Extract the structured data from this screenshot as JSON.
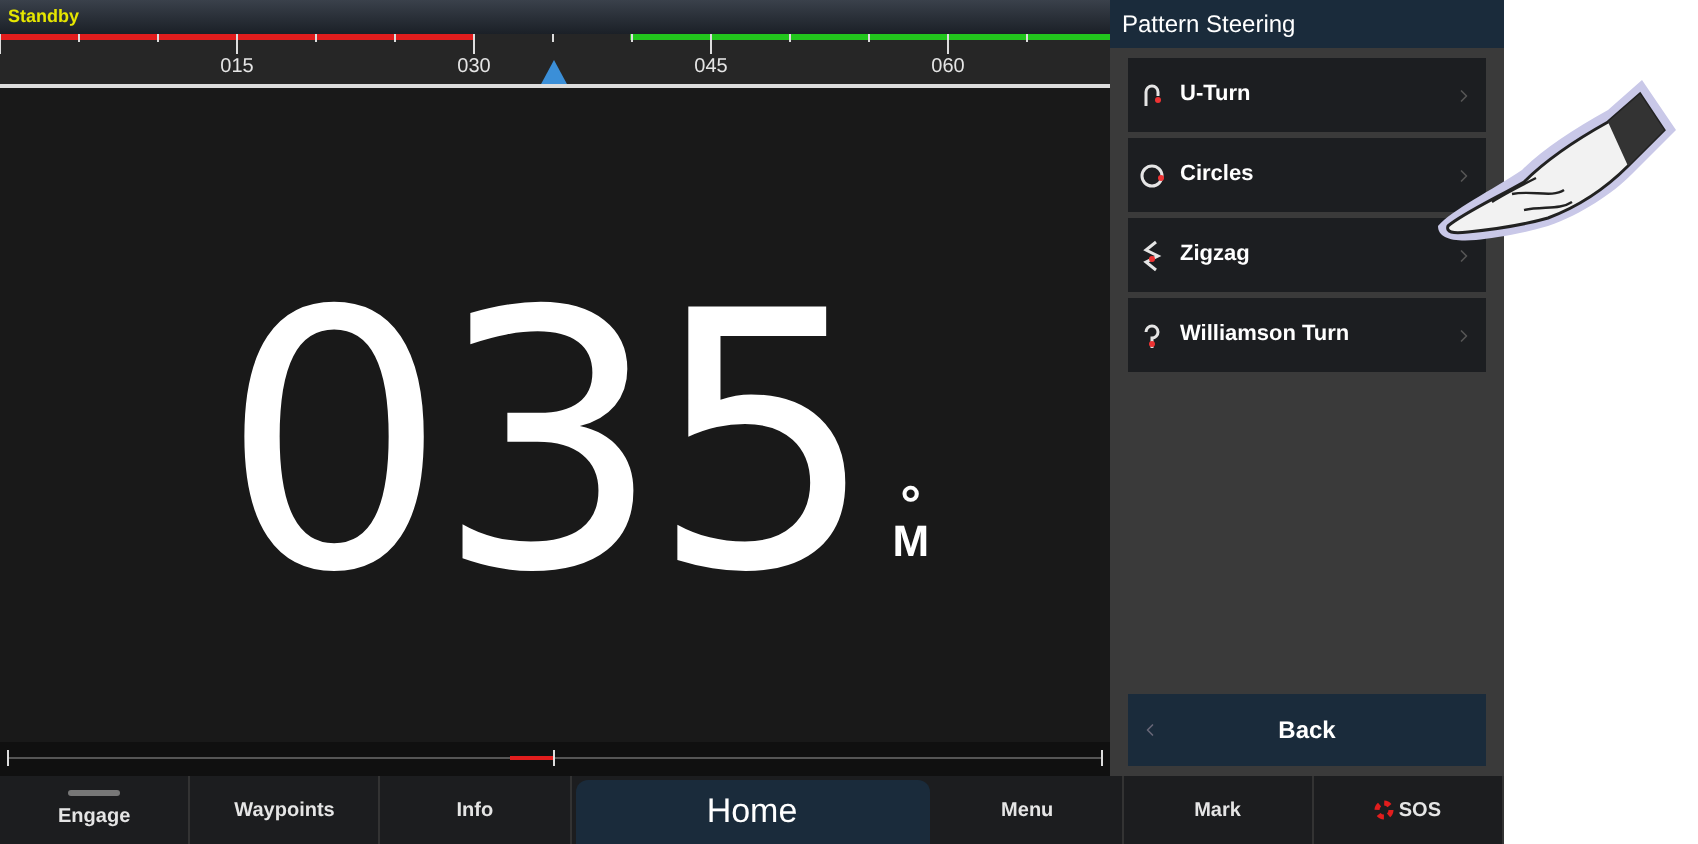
{
  "status": "Standby",
  "compass": {
    "ticks": [
      "015",
      "030",
      "045",
      "060"
    ]
  },
  "heading": {
    "value": "035",
    "degree": "°",
    "reference": "M"
  },
  "panel": {
    "title": "Pattern Steering",
    "items": [
      {
        "label": "U-Turn",
        "kind": "u-turn"
      },
      {
        "label": "Circles",
        "kind": "circles"
      },
      {
        "label": "Zigzag",
        "kind": "zigzag"
      },
      {
        "label": "Williamson Turn",
        "kind": "williamson"
      }
    ],
    "back": "Back"
  },
  "bottom_bar": [
    {
      "label": "Engage",
      "kind": "engage",
      "selected": false
    },
    {
      "label": "Waypoints",
      "kind": "plain",
      "selected": false
    },
    {
      "label": "Info",
      "kind": "plain",
      "selected": false
    },
    {
      "label": "Home",
      "kind": "plain",
      "selected": true
    },
    {
      "label": "Menu",
      "kind": "plain",
      "selected": false
    },
    {
      "label": "Mark",
      "kind": "plain",
      "selected": false
    },
    {
      "label": "SOS",
      "kind": "sos",
      "selected": false
    }
  ]
}
